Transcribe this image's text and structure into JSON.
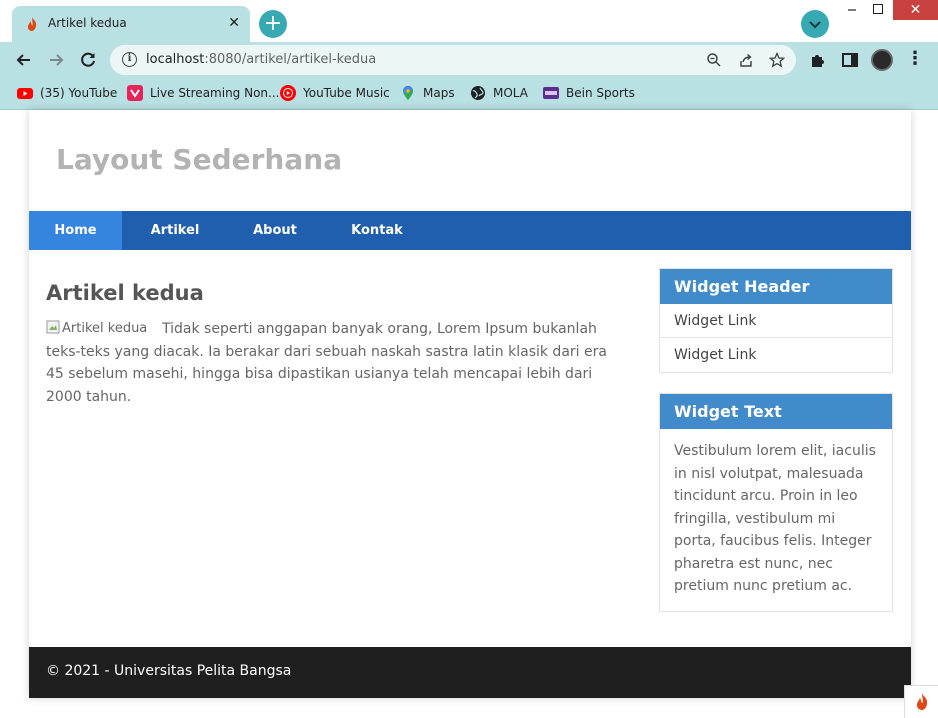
{
  "browser": {
    "tab_title": "Artikel kedua",
    "tab_close": "✕",
    "new_tab": "+",
    "url_host": "localhost",
    "url_path": ":8080/artikel/artikel-kedua",
    "window_minimize": "–",
    "window_close": "✕",
    "theme_color": "#b9e0e3",
    "bookmarks": [
      {
        "label": "(35) YouTube",
        "icon": "youtube-icon"
      },
      {
        "label": "Live Streaming Non...",
        "icon": "vidio-icon"
      },
      {
        "label": "YouTube Music",
        "icon": "youtube-music-icon"
      },
      {
        "label": "Maps",
        "icon": "maps-icon"
      },
      {
        "label": "MOLA",
        "icon": "globe-icon"
      },
      {
        "label": "Bein Sports",
        "icon": "bein-icon"
      }
    ]
  },
  "page": {
    "site_title": "Layout Sederhana",
    "nav": [
      {
        "label": "Home",
        "active": true
      },
      {
        "label": "Artikel",
        "active": false
      },
      {
        "label": "About",
        "active": false
      },
      {
        "label": "Kontak",
        "active": false
      }
    ],
    "article": {
      "title": "Artikel kedua",
      "image_alt": "Artikel kedua",
      "body": "Tidak seperti anggapan banyak orang, Lorem Ipsum bukanlah teks-teks yang diacak. Ia berakar dari sebuah naskah sastra latin klasik dari era 45 sebelum masehi, hingga bisa dipastikan usianya telah mencapai lebih dari 2000 tahun."
    },
    "sidebar": {
      "widget1_header": "Widget Header",
      "widget1_links": [
        "Widget Link",
        "Widget Link"
      ],
      "widget2_header": "Widget Text",
      "widget2_text": "Vestibulum lorem elit, iaculis in nisl volutpat, malesuada tincidunt arcu. Proin in leo fringilla, vestibulum mi porta, faucibus felis. Integer pharetra est nunc, nec pretium nunc pretium ac."
    },
    "footer": "© 2021 - Universitas Pelita Bangsa",
    "colors": {
      "nav_bg": "#1f5fad",
      "nav_active": "#3585df",
      "widget_header": "#428bca",
      "footer_bg": "#1f1f1f",
      "site_title": "#b3b3b3"
    }
  }
}
